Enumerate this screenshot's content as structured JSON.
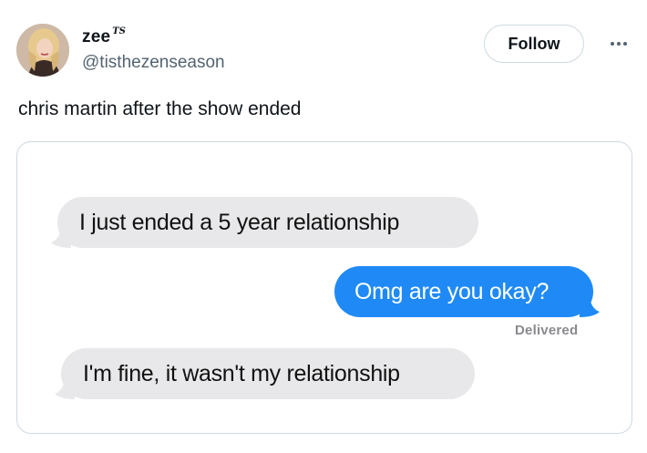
{
  "tweet": {
    "author": {
      "display_name": "zee",
      "name_badge": "TS",
      "handle": "@tisthezenseason"
    },
    "follow_label": "Follow",
    "text": "chris martin after the show ended"
  },
  "media": {
    "messages": [
      {
        "direction": "incoming",
        "text": "I just ended a 5 year relationship"
      },
      {
        "direction": "outgoing",
        "text": "Omg are you okay?"
      },
      {
        "direction": "incoming",
        "text": "I'm fine, it wasn't my relationship"
      }
    ],
    "delivered_label": "Delivered"
  },
  "colors": {
    "outgoing_bubble": "#1f8af6",
    "incoming_bubble": "#e8e8ea",
    "secondary_text": "#536471"
  }
}
